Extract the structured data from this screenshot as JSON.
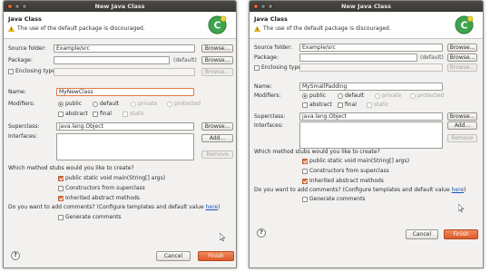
{
  "dialogs": [
    {
      "window_title": "New Java Class",
      "header_title": "Java Class",
      "warning": "The use of the default package is discouraged.",
      "source_folder_label": "Source folder:",
      "source_folder_value": "Example/src",
      "package_label": "Package:",
      "package_value": "",
      "package_default": "(default)",
      "enclosing_type_label": "Enclosing type:",
      "browse_label": "Browse...",
      "name_label": "Name:",
      "name_value": "MyNewClass",
      "modifiers_label": "Modifiers:",
      "mod_public": "public",
      "mod_default": "default",
      "mod_private": "private",
      "mod_protected": "protected",
      "mod_abstract": "abstract",
      "mod_final": "final",
      "mod_static": "static",
      "superclass_label": "Superclass:",
      "superclass_value": "java.lang.Object",
      "interfaces_label": "Interfaces:",
      "add_label": "Add...",
      "remove_label": "Remove",
      "stubs_question": "Which method stubs would you like to create?",
      "stub_main": "public static void main(String[] args)",
      "stub_constructors": "Constructors from superclass",
      "stub_inherited": "Inherited abstract methods",
      "comments_question": "Do you want to add comments? (Configure templates and default value ",
      "comments_link": "here",
      "comments_end": ")",
      "generate_comments": "Generate comments",
      "cancel_label": "Cancel",
      "finish_label": "Finish",
      "help_label": "?"
    },
    {
      "window_title": "New Java Class",
      "header_title": "Java Class",
      "warning": "The use of the default package is discouraged.",
      "source_folder_label": "Source folder:",
      "source_folder_value": "Example/src",
      "package_label": "Package:",
      "package_value": "",
      "package_default": "(default)",
      "enclosing_type_label": "Enclosing type:",
      "browse_label": "Browse...",
      "name_label": "Name:",
      "name_value": "MySmallPadding",
      "modifiers_label": "Modifiers:",
      "mod_public": "public",
      "mod_default": "default",
      "mod_private": "private",
      "mod_protected": "protected",
      "mod_abstract": "abstract",
      "mod_final": "final",
      "mod_static": "static",
      "superclass_label": "Superclass:",
      "superclass_value": "java.lang.Object",
      "interfaces_label": "Interfaces:",
      "add_label": "Add...",
      "remove_label": "Remove",
      "stubs_question": "Which method stubs would you like to create?",
      "stub_main": "public static void main(String[] args)",
      "stub_constructors": "Constructors from superclass",
      "stub_inherited": "Inherited abstract methods",
      "comments_question": "Do you want to add comments? (Configure templates and default value ",
      "comments_link": "here",
      "comments_end": ")",
      "generate_comments": "Generate comments",
      "cancel_label": "Cancel",
      "finish_label": "Finish",
      "help_label": "?"
    }
  ],
  "icons": {
    "warning": "warning-icon",
    "wizard_banner": "java-class-wizard-icon",
    "help": "help-icon",
    "cursor": "mouse-cursor-icon"
  },
  "colors": {
    "title_bar": "#3f3e3a",
    "accent": "#e07b48",
    "link": "#1a56b8",
    "close_button": "#e9612d",
    "banner_icon": "#4caf50"
  }
}
